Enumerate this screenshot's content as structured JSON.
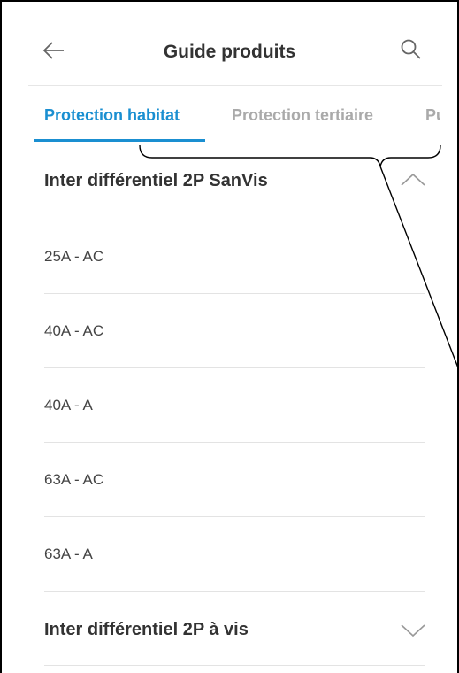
{
  "header": {
    "title": "Guide produits",
    "back_icon": "arrow-left-icon",
    "search_icon": "search-icon"
  },
  "tabs": [
    {
      "label": "Protection habitat",
      "active": true
    },
    {
      "label": "Protection tertiaire",
      "active": false
    },
    {
      "label": "Pu",
      "active": false
    }
  ],
  "colors": {
    "accent": "#1a8fd1",
    "inactive_tab": "#aaaaaa",
    "text": "#333333"
  },
  "sections": [
    {
      "title": "Inter différentiel 2P SanVis",
      "expanded": true,
      "chevron_icon": "chevron-up-icon",
      "items": [
        "25A - AC",
        "40A - AC",
        "40A - A",
        "63A - AC",
        "63A - A"
      ]
    },
    {
      "title": "Inter différentiel 2P à vis",
      "expanded": false,
      "chevron_icon": "chevron-down-icon",
      "items": []
    }
  ]
}
